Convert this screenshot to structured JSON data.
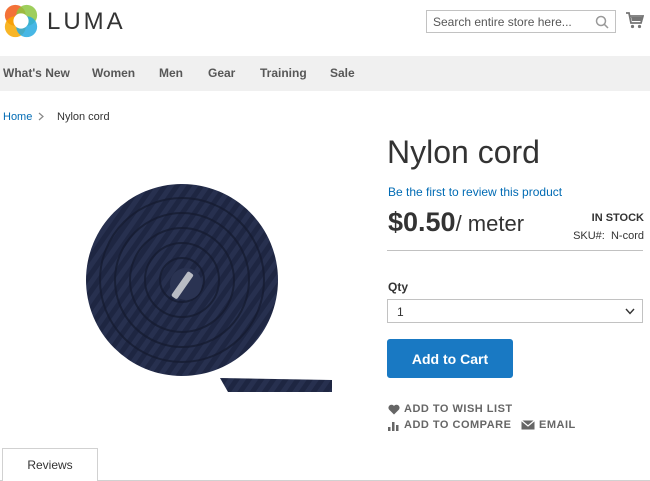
{
  "header": {
    "brand": "LUMA",
    "search": {
      "placeholder": "Search entire store here..."
    }
  },
  "nav": {
    "items": [
      "What's New",
      "Women",
      "Men",
      "Gear",
      "Training",
      "Sale"
    ]
  },
  "breadcrumb": {
    "home": "Home",
    "current": "Nylon cord"
  },
  "product": {
    "name": "Nylon cord",
    "review_link": "Be the first to review this product",
    "price": "$0.50",
    "unit": "/ meter",
    "stock": "IN STOCK",
    "sku_label": "SKU#:",
    "sku_value": "N-cord",
    "qty_label": "Qty",
    "qty_value": "1",
    "add_to_cart": "Add to Cart",
    "wish_list": "ADD TO WISH LIST",
    "compare": "ADD TO COMPARE",
    "email": "EMAIL"
  },
  "tabs": [
    "Reviews"
  ],
  "colors": {
    "accent": "#1979c3",
    "link": "#006bb4",
    "nav_bg": "#f0f0f0"
  }
}
